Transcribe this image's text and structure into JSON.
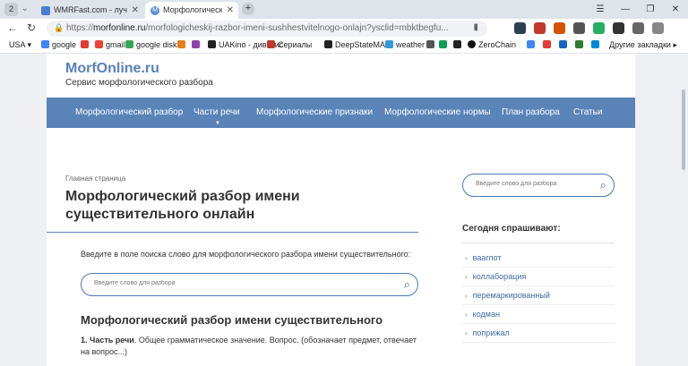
{
  "browser": {
    "tab_count": "2",
    "tabs": [
      {
        "title": "WMRFast.com - лучшее м",
        "active": false
      },
      {
        "title": "Морфологический раз",
        "active": true
      }
    ],
    "url_host": "morfonline.ru",
    "url_path": "/morfologicheskij-razbor-imeni-sushhestvitelnogo-onlajn?ysclid=mbktbegfu...",
    "url_prefix": "https://",
    "bookmarks": [
      "USA",
      "google",
      "gmail",
      "google disk",
      "",
      "",
      "UAKino - дивитис",
      "Сериалы",
      "DeepStateMAP",
      "weather",
      "",
      "",
      "",
      "ZeroChain",
      "",
      "",
      "",
      "",
      "",
      ""
    ],
    "bookmarks_right": "Другие закладки"
  },
  "site": {
    "logo": "MorfOnline.ru",
    "tagline": "Сервис морфологического разбора",
    "nav": [
      "Морфологический разбор",
      "Части речи",
      "Морфологические признаки",
      "Морфологические нормы",
      "План разбора",
      "Статьи"
    ]
  },
  "main": {
    "breadcrumb": "Главная страница",
    "heading": "Морфологический разбор имени существительного онлайн",
    "hint": "Введите в поле поиска слово для морфологического разбора имени существительного:",
    "search_placeholder": "Введите слово для разбора",
    "subheading": "Морфологический разбор имени существительного",
    "para_bold": "1. Часть речи",
    "para_rest": ". Общее грамматическое значение. Вопрос. (обозначает предмет, отвечает на вопрос...)"
  },
  "sidebar": {
    "search_placeholder": "Введите слово для разбора",
    "asked_title": "Сегодня спрашивают:",
    "asked_words": [
      "ваагпот",
      "коллаборация",
      "перемаркированный",
      "кодман",
      "поприжал"
    ]
  },
  "colors": {
    "nav_bg": "#5a83b8",
    "logo": "#5b7fbf",
    "link": "#3f6aa5"
  }
}
